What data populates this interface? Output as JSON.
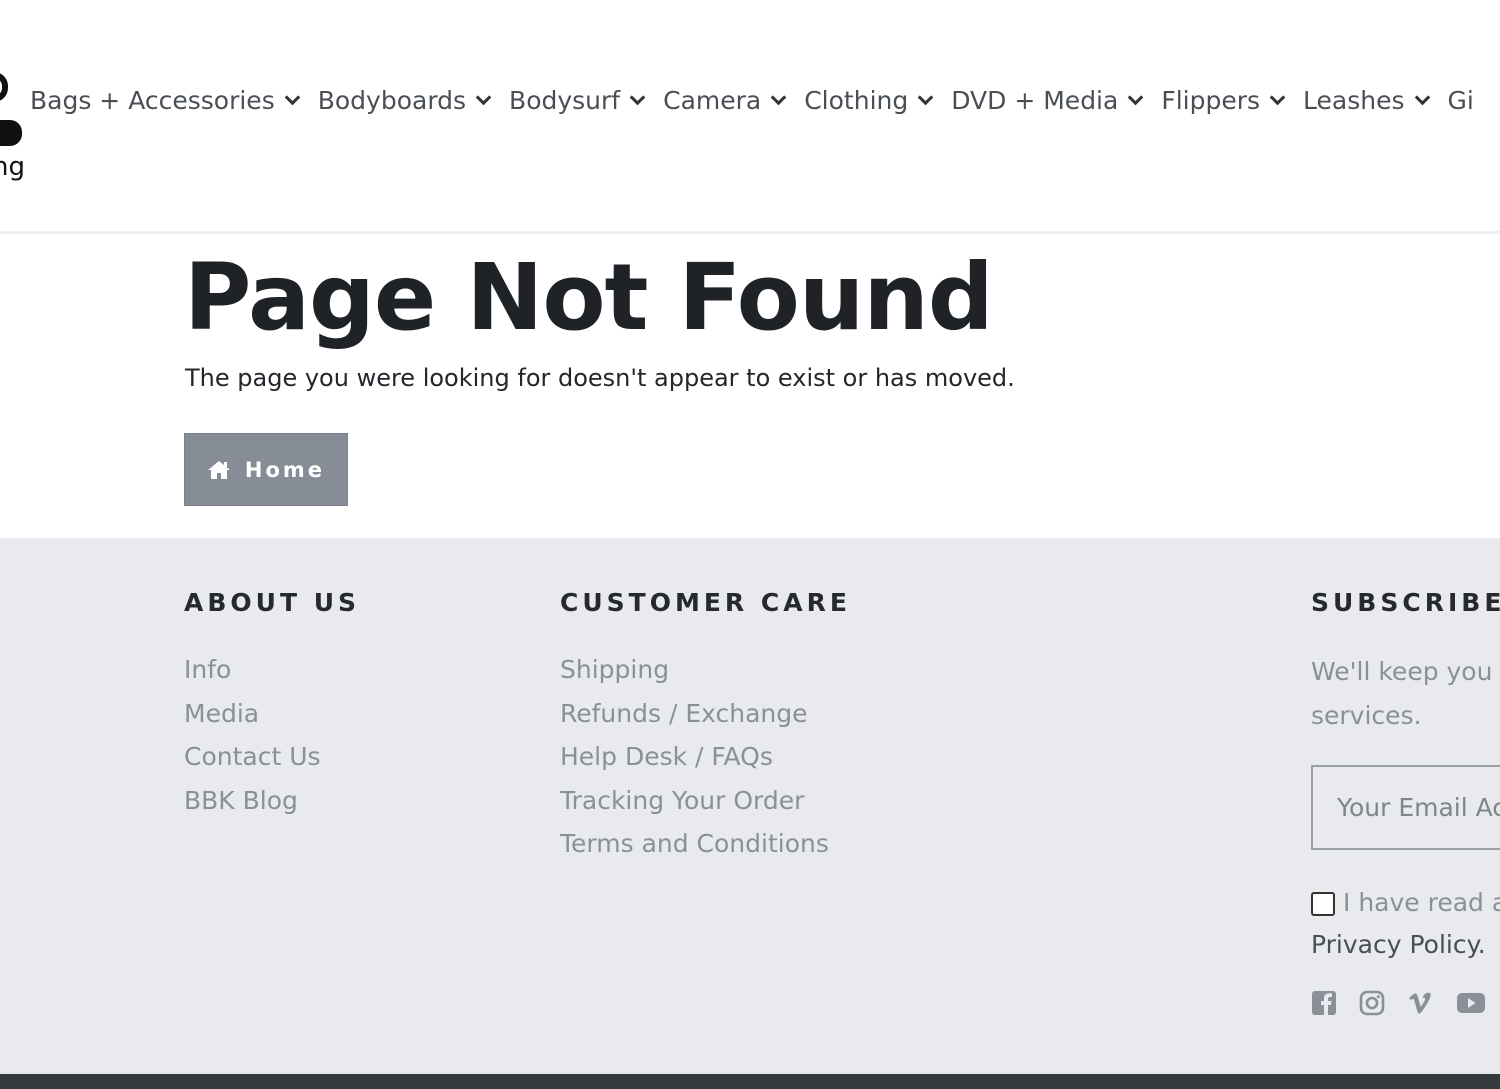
{
  "header": {
    "logo_text": "ng",
    "nav": [
      {
        "label": "Bags + Accessories"
      },
      {
        "label": "Bodyboards"
      },
      {
        "label": "Bodysurf"
      },
      {
        "label": "Camera"
      },
      {
        "label": "Clothing"
      },
      {
        "label": "DVD + Media"
      },
      {
        "label": "Flippers"
      },
      {
        "label": "Leashes"
      },
      {
        "label": "Gi"
      }
    ]
  },
  "main": {
    "title": "Page Not Found",
    "message": "The page you were looking for doesn't appear to exist or has moved.",
    "home_button": "Home"
  },
  "footer": {
    "about": {
      "title": "ABOUT US",
      "links": [
        "Info",
        "Media",
        "Contact Us",
        "BBK Blog"
      ]
    },
    "care": {
      "title": "CUSTOMER CARE",
      "links": [
        "Shipping",
        "Refunds / Exchange",
        "Help Desk / FAQs",
        "Tracking Your Order",
        "Terms and Conditions"
      ]
    },
    "subscribe": {
      "title": "SUBSCRIBE T",
      "text_line1": "We'll keep you",
      "text_line2": "services.",
      "email_placeholder": "Your Email Ac",
      "consent_text": "I have read a",
      "privacy_link": "Privacy Policy."
    },
    "socials": [
      "facebook-icon",
      "instagram-icon",
      "vimeo-icon",
      "youtube-icon"
    ],
    "link_color": "#8a9098"
  },
  "colors": {
    "home_button_bg": "#868d96",
    "footer_bg": "#e9eaed",
    "bottom_bar": "#35393e"
  }
}
